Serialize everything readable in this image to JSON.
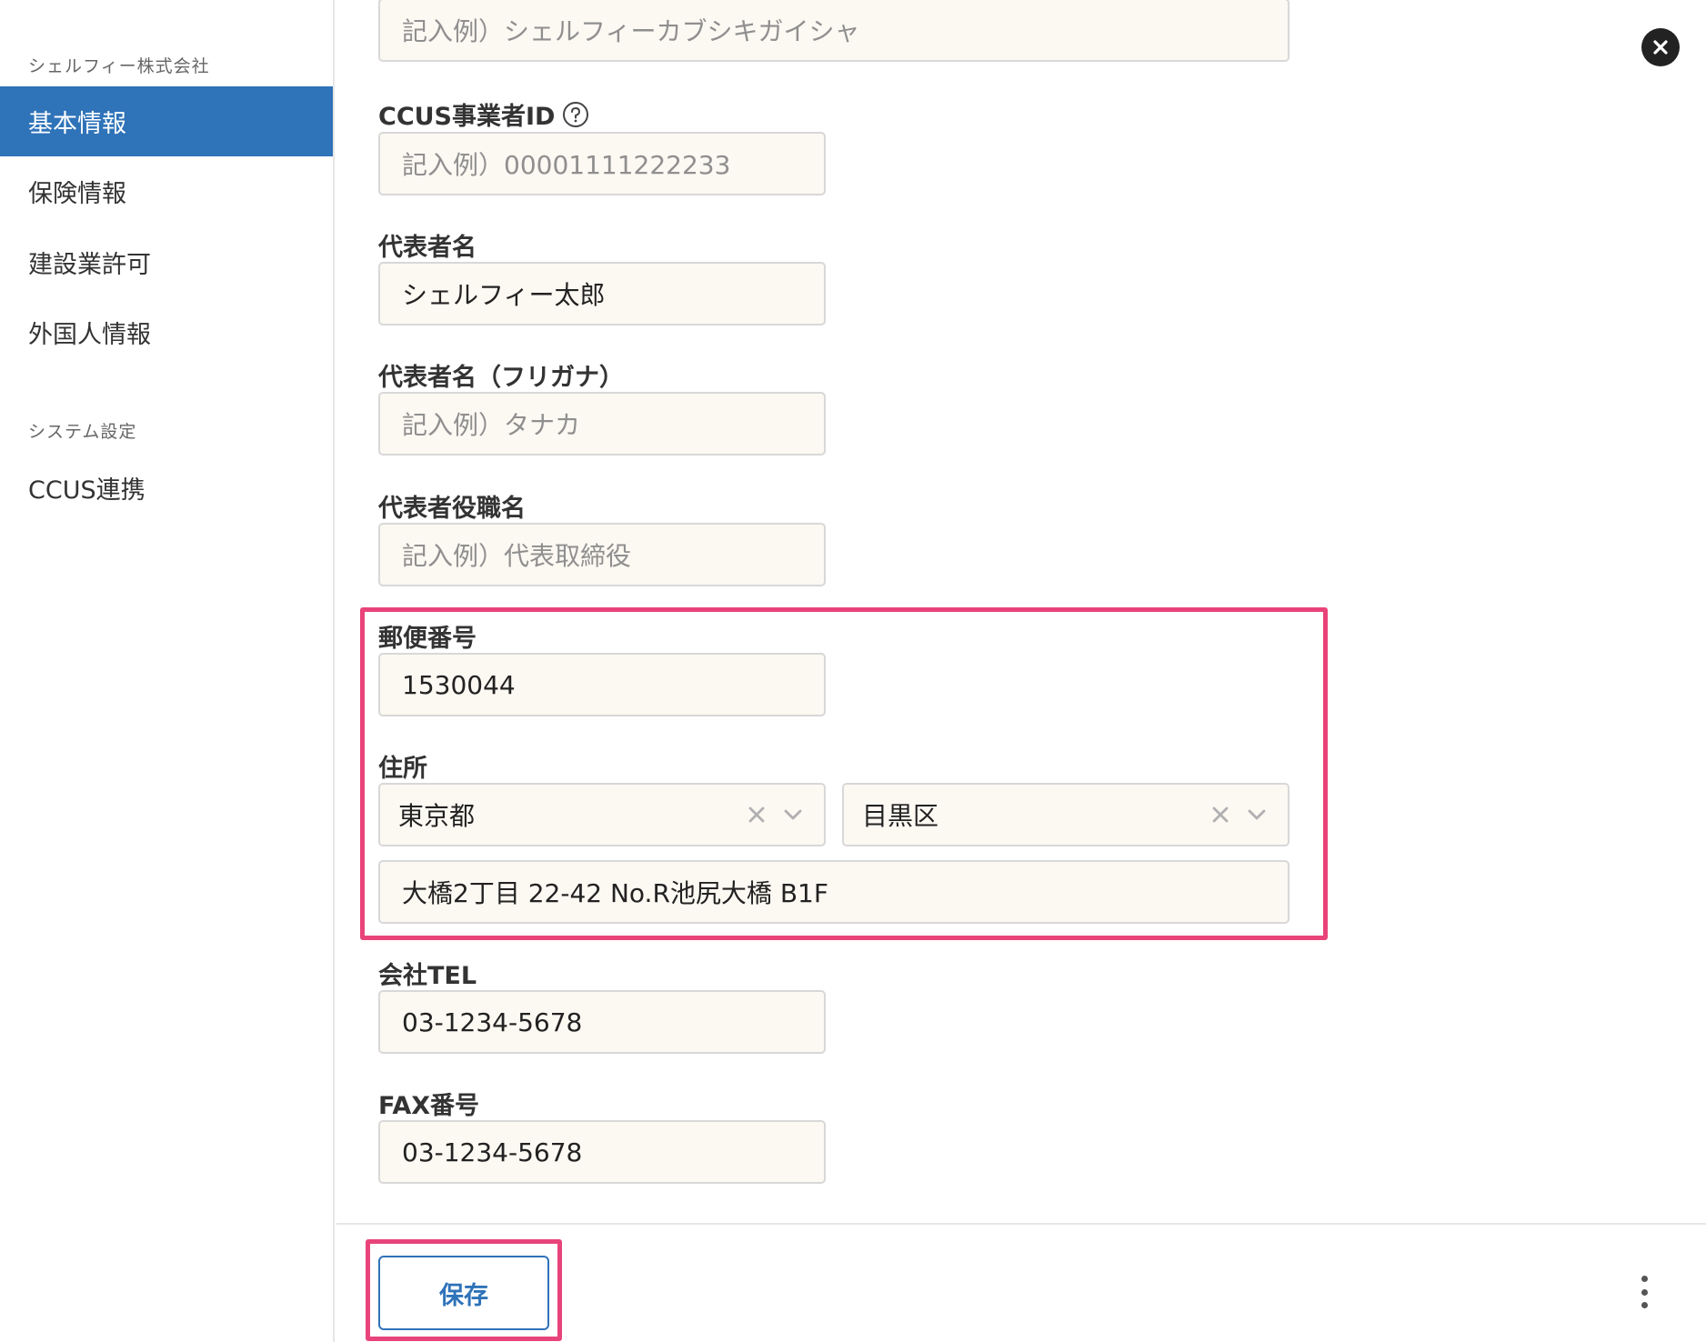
{
  "sidebar": {
    "company_label": "シェルフィー株式会社",
    "items": [
      {
        "label": "基本情報",
        "active": true
      },
      {
        "label": "保険情報",
        "active": false
      },
      {
        "label": "建設業許可",
        "active": false
      },
      {
        "label": "外国人情報",
        "active": false
      }
    ],
    "system_label": "システム設定",
    "system_items": [
      {
        "label": "CCUS連携"
      }
    ]
  },
  "form": {
    "company_kana": {
      "placeholder": "記入例）シェルフィーカブシキガイシャ",
      "value": ""
    },
    "ccus_id": {
      "label": "CCUS事業者ID",
      "placeholder": "記入例）00001111222233",
      "value": ""
    },
    "rep_name": {
      "label": "代表者名",
      "value": "シェルフィー太郎"
    },
    "rep_kana": {
      "label": "代表者名（フリガナ）",
      "placeholder": "記入例）タナカ",
      "value": ""
    },
    "rep_title": {
      "label": "代表者役職名",
      "placeholder": "記入例）代表取締役",
      "value": ""
    },
    "postal_code": {
      "label": "郵便番号",
      "value": "1530044"
    },
    "address": {
      "label": "住所",
      "prefecture": "東京都",
      "city": "目黒区",
      "street": "大橋2丁目 22-42 No.R池尻大橋 B1F"
    },
    "tel": {
      "label": "会社TEL",
      "value": "03-1234-5678"
    },
    "fax": {
      "label": "FAX番号",
      "value": "03-1234-5678"
    }
  },
  "footer": {
    "save_label": "保存"
  },
  "colors": {
    "accent": "#2f73b9",
    "highlight": "#e8447a",
    "input_bg": "#fcf8f2"
  },
  "icons": {
    "close": "close-icon",
    "help": "help-icon",
    "clear": "clear-icon",
    "chevron": "chevron-down-icon",
    "more": "more-vertical-icon"
  }
}
